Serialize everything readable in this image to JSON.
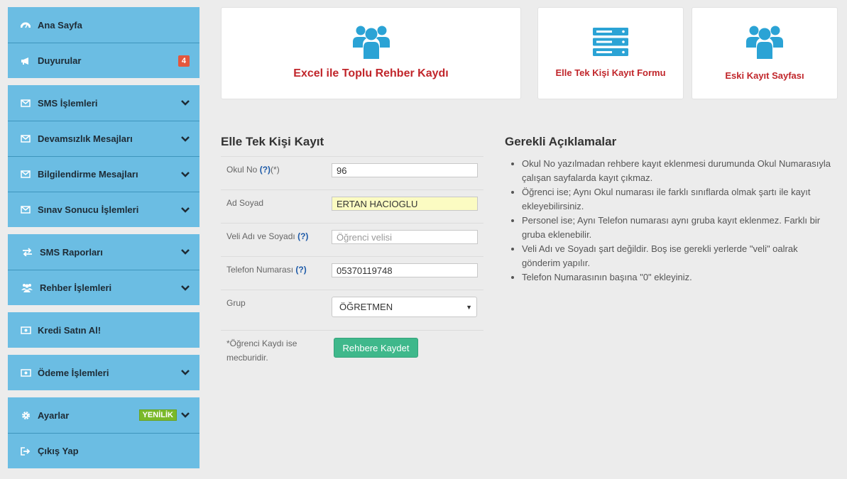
{
  "sidebar": {
    "items": [
      {
        "label": "Ana Sayfa",
        "icon": "dashboard-icon"
      },
      {
        "label": "Duyurular",
        "icon": "megaphone-icon",
        "badge": "4"
      },
      {
        "label": "SMS İşlemleri",
        "icon": "envelope-icon"
      },
      {
        "label": "Devamsızlık Mesajları",
        "icon": "envelope-icon"
      },
      {
        "label": "Bilgilendirme Mesajları",
        "icon": "envelope-icon"
      },
      {
        "label": "Sınav Sonucu İşlemleri",
        "icon": "envelope-icon"
      },
      {
        "label": "SMS Raporları",
        "icon": "exchange-icon"
      },
      {
        "label": "Rehber İşlemleri",
        "icon": "users-icon"
      },
      {
        "label": "Kredi Satın Al!",
        "icon": "money-icon"
      },
      {
        "label": "Ödeme İşlemleri",
        "icon": "money-icon"
      },
      {
        "label": "Ayarlar",
        "icon": "gear-icon",
        "badge": "YENİLİK"
      },
      {
        "label": "Çıkış Yap",
        "icon": "sign-out-icon"
      }
    ]
  },
  "cards": [
    {
      "title": "Excel ile Toplu Rehber Kaydı",
      "icon": "users-icon"
    },
    {
      "title": "Elle Tek Kişi Kayıt Formu",
      "icon": "server-icon"
    },
    {
      "title": "Eski Kayıt Sayfası",
      "icon": "users-icon"
    }
  ],
  "form": {
    "title": "Elle Tek Kişi Kayıt",
    "okul_no": {
      "label": "Okul No",
      "help": "(?)",
      "required": "(*)",
      "value": "96"
    },
    "ad_soyad": {
      "label": "Ad Soyad",
      "value": "ERTAN HACIOGLU"
    },
    "veli": {
      "label": "Veli Adı ve Soyadı",
      "help": "(?)",
      "placeholder": "Öğrenci velisi"
    },
    "telefon": {
      "label": "Telefon Numarası",
      "help": "(?)",
      "value": "05370119748"
    },
    "grup": {
      "label": "Grup",
      "selected": "ÖĞRETMEN"
    },
    "note_line1": "*Öğrenci Kaydı ise",
    "note_line2": "mecburidir.",
    "submit": "Rehbere Kaydet"
  },
  "explanations": {
    "title": "Gerekli Açıklamalar",
    "items": [
      "Okul No yazılmadan rehbere kayıt eklenmesi durumunda Okul Numarasıyla çalışan sayfalarda kayıt çıkmaz.",
      "Öğrenci ise; Aynı Okul numarası ile farklı sınıflarda olmak şartı ile kayıt ekleyebilirsiniz.",
      "Personel ise; Aynı Telefon numarası aynı gruba kayıt eklenmez. Farklı bir gruba eklenebilir.",
      "Veli Adı ve Soyadı şart değildir. Boş ise gerekli yerlerde \"veli\" oalrak gönderim yapılır.",
      "Telefon Numarasının başına \"0\" ekleyiniz."
    ]
  },
  "colors": {
    "sidebar_bg": "#6bbde3",
    "card_title": "#c1262b",
    "icon_blue": "#2ba3d5",
    "save_button": "#3fb88b",
    "badge_red": "#e4573d",
    "badge_green": "#7ab929"
  }
}
